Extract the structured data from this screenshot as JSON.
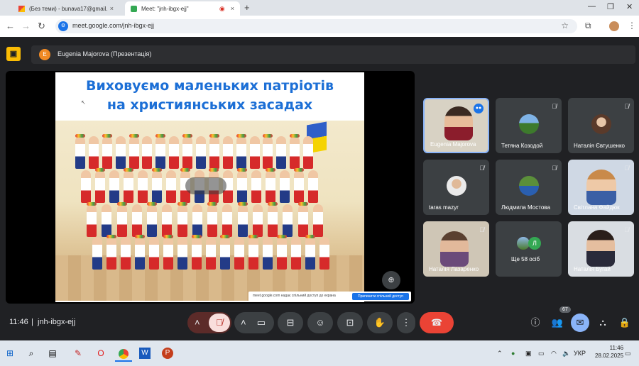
{
  "browser": {
    "tabs": [
      {
        "title": "(Без теми) - bunava17@gmail.",
        "favicon": "gmail"
      },
      {
        "title": "Meet: \"jnh-ibgx-ejj\"",
        "favicon": "meet"
      }
    ],
    "new_tab_symbol": "+",
    "url": "meet.google.com/jnh-ibgx-ejj"
  },
  "meeting": {
    "presenter_initial": "E",
    "presenter_label": "Eugenia Majorova (Презентація)",
    "slide_title_line1": "Виховуємо маленьких патріотів",
    "slide_title_line2": "на християнських засадах",
    "share_notice": "meet.google.com надає спільний доступ до екрана",
    "share_stop": "Припинити спільний доступ",
    "participants": [
      {
        "name": "Eugenia Majorova",
        "type": "video",
        "active": true
      },
      {
        "name": "Тетяна Козодой",
        "type": "avatar"
      },
      {
        "name": "Наталія Євтушенко",
        "type": "avatar"
      },
      {
        "name": "taras mazyr",
        "type": "avatar"
      },
      {
        "name": "Людмила Мостова",
        "type": "avatar"
      },
      {
        "name": "Світлана Файдюк",
        "type": "video"
      },
      {
        "name": "Наталія Лазаренко",
        "type": "video"
      },
      {
        "name": "Ще 58 осіб",
        "type": "more",
        "initial": "Л"
      },
      {
        "name": "Наталія Бугай",
        "type": "video"
      }
    ],
    "time": "11:46",
    "code": "jnh-ibgx-ejj",
    "people_count": "67"
  },
  "taskbar": {
    "lang": "УКР",
    "time": "11:46",
    "date": "28.02.2025"
  },
  "colors": {
    "end_call": "#ea4335",
    "mic_off": "#f9dedc",
    "accent": "#8ab4f8"
  }
}
